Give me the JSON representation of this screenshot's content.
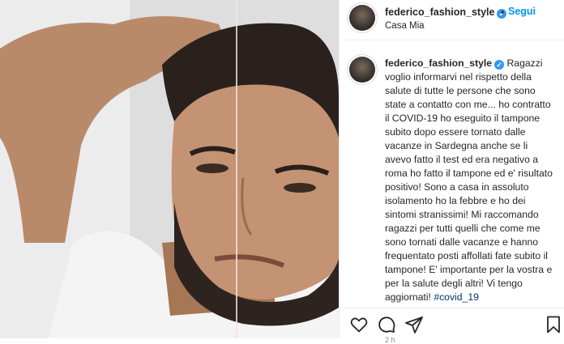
{
  "post": {
    "username": "federico_fashion_style",
    "verified_mark": "✓",
    "separator": "•",
    "follow_label": "Segui",
    "location": "Casa Mia",
    "caption_text": "Ragazzi voglio informarvi nel rispetto della salute di tutte le persone che sono state a contatto con me... ho contratto il COVID-19 ho eseguito il tampone subito dopo essere tornato dalle vacanze in Sardegna anche se li avevo fatto il test ed era negativo a roma ho fatto il tampone ed e' risultato positivo! Sono a casa in assoluto isolamento ho la febbre e ho dei sintomi stranissimi! Mi raccomando ragazzi per tutti quelli che come me sono tornati dalle vacanze e hanno frequentato posti affollati fate subito il tampone! E' importante per la vostra e per la salute degli altri! Vi tengo aggiornati!",
    "hashtag": "#covid_19",
    "timestamp": "2 h"
  },
  "icons": {
    "like": "heart-icon",
    "comment": "comment-icon",
    "share": "share-icon",
    "save": "bookmark-icon"
  },
  "colors": {
    "follow": "#0095f6",
    "verified": "#3897f0",
    "hashtag": "#00376b",
    "text": "#262626",
    "muted": "#8e8e8e"
  }
}
